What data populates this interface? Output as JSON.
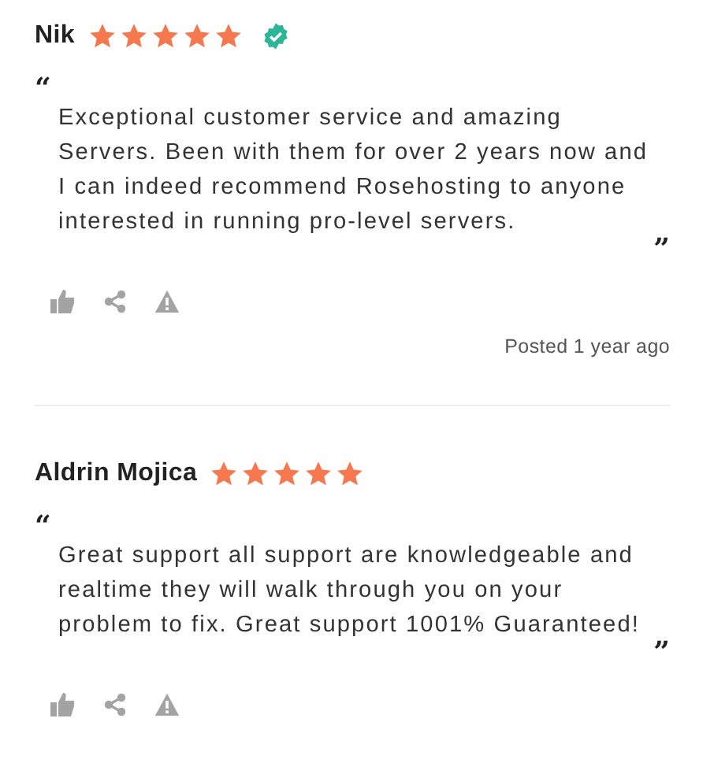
{
  "reviews": [
    {
      "name": "Nik",
      "stars": 5,
      "verified": true,
      "open_quote": "“",
      "text": "Exceptional customer service and amazing Servers. Been with them for over 2 years now and I can indeed recommend Rosehosting to anyone interested in running pro-level servers.",
      "close_quote": "”",
      "posted": "Posted 1 year ago"
    },
    {
      "name": "Aldrin Mojica",
      "stars": 5,
      "verified": false,
      "open_quote": "“",
      "text": "Great support all support are knowledgeable and realtime they will walk through you on your problem to fix. Great support 1001% Guaranteed!",
      "close_quote": "”"
    }
  ]
}
